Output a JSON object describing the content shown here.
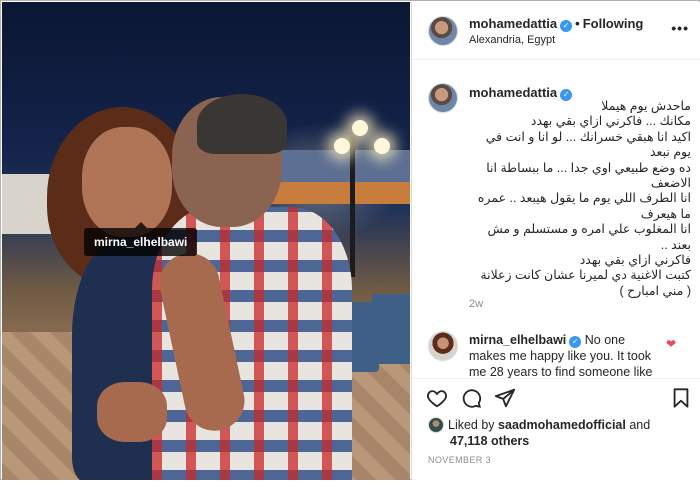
{
  "post": {
    "tagged_user": "mirna_elhelbawi"
  },
  "header": {
    "username": "mohamedattia",
    "separator": "•",
    "follow_state": "Following",
    "location": "Alexandria, Egypt",
    "more": "•••"
  },
  "caption": {
    "username": "mohamedattia",
    "text": "ماحدش يوم هيملا\nمكانك ... فاكرني ازاي بقي بهدد\nاكيد انا هبقي خسرانك ... لو انا و انت في\nيوم نبعد\nده وضع طبيعي اوي جدا ... ما ببساطة انا\nالاضعف\nانا الطرف اللي يوم ما يقول هيبعد .. عمره\nما هيعرف\nانا المغلوب علي امره و مستسلم و مش\nبعند ..\nفاكرني ازاي بقي بهدد\nكتبت الاغنية دي لميرنا عشان كانت زعلانة\n( مني امبارح )",
    "time": "2w"
  },
  "comment": {
    "username": "mirna_elhelbawi",
    "text": "No one makes me happy like you. It took me 28 years to find someone like"
  },
  "likes": {
    "prefix": "Liked by",
    "by_user": "saadmohamedofficial",
    "and": "and",
    "count": "47,118 others"
  },
  "date": "NOVEMBER 3",
  "icons": {
    "like": "heart-icon",
    "comment": "comment-icon",
    "share": "share-icon",
    "save": "bookmark-icon",
    "verified": "verified-badge-icon"
  },
  "colors": {
    "verified": "#3897f0",
    "like_red": "#ed4956",
    "muted": "#8e8e8e"
  }
}
